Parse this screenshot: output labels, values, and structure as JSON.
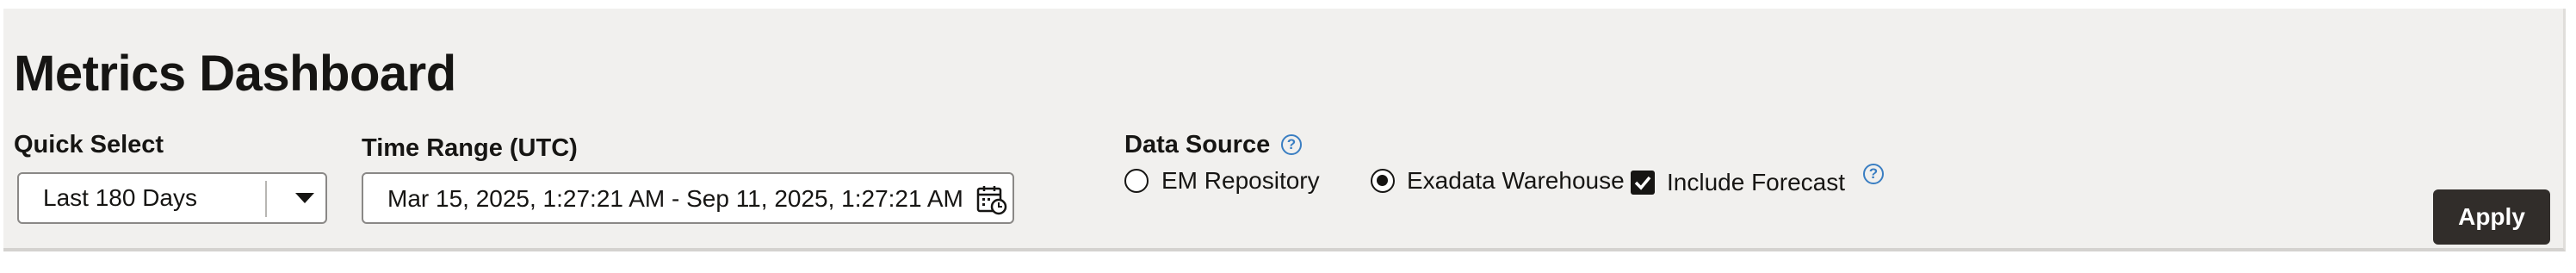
{
  "header": {
    "title": "Metrics Dashboard"
  },
  "quick_select": {
    "label": "Quick Select",
    "value": "Last 180 Days"
  },
  "time_range": {
    "label": "Time Range (UTC)",
    "value": "Mar 15, 2025, 1:27:21 AM - Sep 11, 2025, 1:27:21 AM"
  },
  "data_source": {
    "label": "Data Source",
    "options": [
      {
        "label": "EM Repository",
        "selected": false
      },
      {
        "label": "Exadata Warehouse",
        "selected": true
      }
    ]
  },
  "forecast": {
    "label": "Include Forecast",
    "checked": true
  },
  "apply_label": "Apply",
  "icons": {
    "help": "?",
    "dropdown": "caret-down-icon",
    "calendar": "calendar-clock-icon"
  },
  "colors": {
    "accent": "#3a7ec2",
    "button": "#312d2a",
    "panel": "#f1f0ee"
  }
}
